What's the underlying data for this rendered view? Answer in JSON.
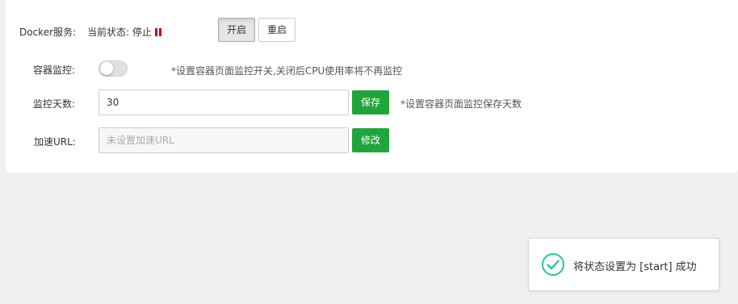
{
  "docker": {
    "label": "Docker服务:",
    "status_text": "当前状态: 停止",
    "start_button": "开启",
    "restart_button": "重启",
    "stop_color": "#cc0000"
  },
  "monitor": {
    "label": "容器监控:",
    "enabled": false,
    "hint": "*设置容器页面监控开关,关闭后CPU使用率将不再监控"
  },
  "monitor_days": {
    "label": "监控天数:",
    "value": "30",
    "save_button": "保存",
    "hint": "*设置容器页面监控保存天数"
  },
  "accel_url": {
    "label": "加速URL:",
    "placeholder": "未设置加速URL",
    "edit_button": "修改"
  },
  "toast": {
    "message": "将状态设置为 [start] 成功",
    "icon_color": "#20c997"
  },
  "colors": {
    "success": "#20a53a",
    "background": "#f0f0f0"
  }
}
